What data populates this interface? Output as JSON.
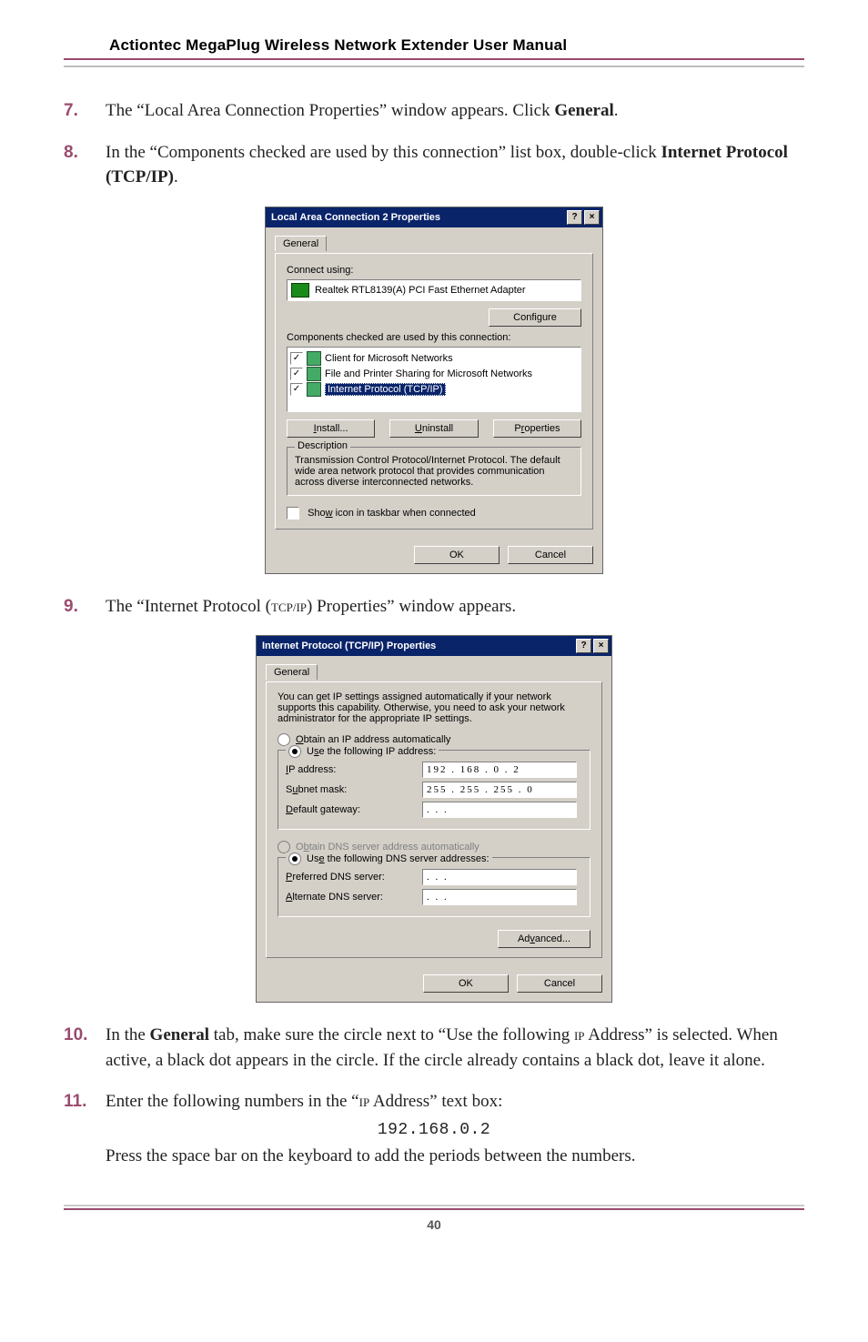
{
  "header": {
    "title": "Actiontec MegaPlug Wireless Network Extender User Manual"
  },
  "steps": {
    "s7": {
      "num": "7.",
      "text_a": "The “Local Area Connection Properties” window appears. Click ",
      "bold": "General",
      "text_b": "."
    },
    "s8": {
      "num": "8.",
      "text_a": "In the “Components checked are used by this connection” list box, double-click ",
      "bold": "Internet Protocol (TCP/IP)",
      "text_b": "."
    },
    "s9": {
      "num": "9.",
      "text_a": "The “Internet Protocol (",
      "sc": "TCP/IP",
      "text_b": ") Properties” window appears."
    },
    "s10": {
      "num": "10.",
      "text_a": "In the ",
      "bold": "General",
      "text_b": " tab, make sure the circle next to “Use the following ",
      "sc": "IP",
      "text_c": " Address” is selected. When active, a black dot appears in the circle.  If the circle already contains a black dot, leave it alone."
    },
    "s11": {
      "num": "11.",
      "text_a": "Enter the following numbers in the “",
      "sc": "IP",
      "text_b": " Address” text box:",
      "mono": "192.168.0.2",
      "text_c": "Press the space bar on the keyboard to add the periods between the numbers."
    }
  },
  "dialog1": {
    "title": "Local Area Connection 2 Properties",
    "help": "?",
    "close": "×",
    "tab_general": "General",
    "connect_using": "Connect using:",
    "adapter": "Realtek RTL8139(A) PCI Fast Ethernet Adapter",
    "configure": "Configure",
    "components_label": "Components checked are used by this connection:",
    "comp1": "Client for Microsoft Networks",
    "comp2": "File and Printer Sharing for Microsoft Networks",
    "comp3": "Internet Protocol (TCP/IP)",
    "install": "Install...",
    "uninstall": "Uninstall",
    "properties": "Properties",
    "desc_legend": "Description",
    "desc_text": "Transmission Control Protocol/Internet Protocol. The default wide area network protocol that provides communication across diverse interconnected networks.",
    "show_icon": "Show icon in taskbar when connected",
    "ok": "OK",
    "cancel": "Cancel",
    "check": "✓"
  },
  "dialog2": {
    "title": "Internet Protocol (TCP/IP) Properties",
    "help": "?",
    "close": "×",
    "tab_general": "General",
    "blurb": "You can get IP settings assigned automatically if your network supports this capability. Otherwise, you need to ask your network administrator for the appropriate IP settings.",
    "r1": "Obtain an IP address automatically",
    "r2": "Use the following IP address:",
    "ip_label": "IP address:",
    "ip_value": "192 . 168 .  0  .  2",
    "mask_label": "Subnet mask:",
    "mask_value": "255 . 255 . 255 .  0",
    "gw_label": "Default gateway:",
    "gw_value": " .       .       .",
    "r3": "Obtain DNS server address automatically",
    "r4": "Use the following DNS server addresses:",
    "pdns_label": "Preferred DNS server:",
    "adns_label": "Alternate DNS server:",
    "dns_blank": " .       .       .",
    "advanced": "Advanced...",
    "ok": "OK",
    "cancel": "Cancel"
  },
  "footer": {
    "page": "40"
  }
}
